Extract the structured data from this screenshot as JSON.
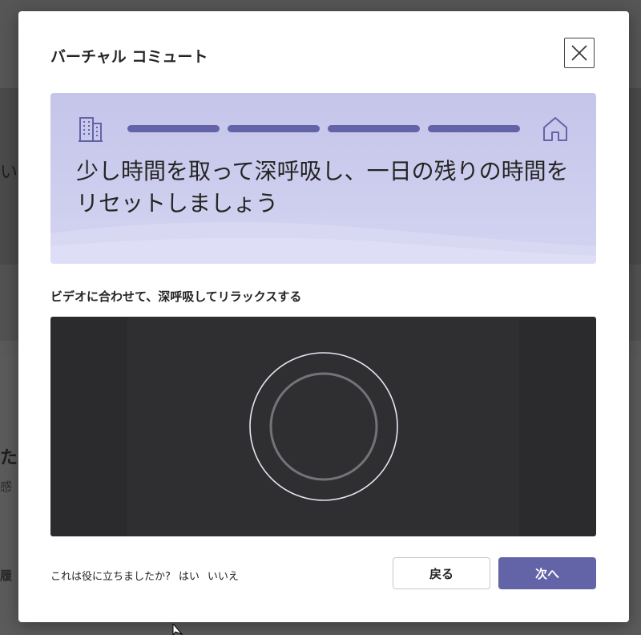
{
  "background": {
    "fragments": [
      "いも",
      "た",
      "感",
      "履"
    ]
  },
  "dialog": {
    "title": "バーチャル コミュート",
    "close_icon": "close-icon"
  },
  "hero": {
    "text": "少し時間を取って深呼吸し、一日の残りの時間をリセットしましょう",
    "progress_segments": 4,
    "start_icon": "building-icon",
    "end_icon": "home-icon",
    "accent_color": "#6264a7"
  },
  "video": {
    "caption": "ビデオに合わせて、深呼吸してリラックスする"
  },
  "feedback": {
    "question": "これは役に立ちましたか?",
    "yes": "はい",
    "no": "いいえ"
  },
  "buttons": {
    "back": "戻る",
    "next": "次へ"
  }
}
